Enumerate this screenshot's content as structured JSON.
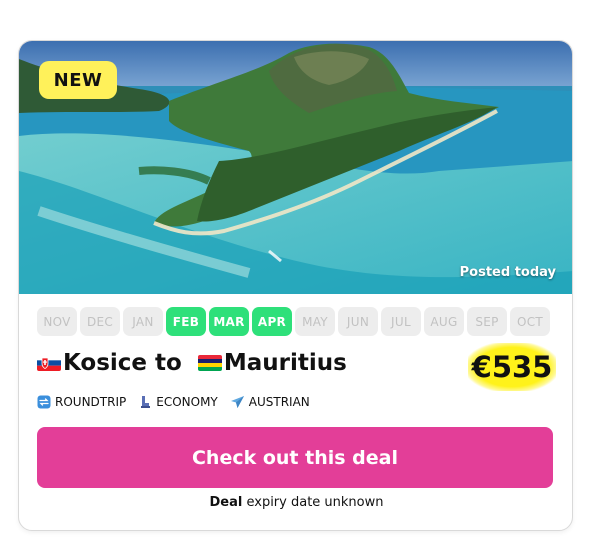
{
  "badge": {
    "label": "NEW"
  },
  "hero": {
    "posted": "Posted today"
  },
  "months": [
    {
      "label": "NOV",
      "active": false
    },
    {
      "label": "DEC",
      "active": false
    },
    {
      "label": "JAN",
      "active": false
    },
    {
      "label": "FEB",
      "active": true
    },
    {
      "label": "MAR",
      "active": true
    },
    {
      "label": "APR",
      "active": true
    },
    {
      "label": "MAY",
      "active": false
    },
    {
      "label": "JUN",
      "active": false
    },
    {
      "label": "JUL",
      "active": false
    },
    {
      "label": "AUG",
      "active": false
    },
    {
      "label": "SEP",
      "active": false
    },
    {
      "label": "OCT",
      "active": false
    }
  ],
  "route": {
    "origin": "Kosice",
    "connector": " to ",
    "destination": "Mauritius"
  },
  "price": {
    "label": "€535"
  },
  "meta": {
    "trip_type": "ROUNDTRIP",
    "cabin": "ECONOMY",
    "airline": "AUSTRIAN"
  },
  "cta": {
    "label": "Check out this deal"
  },
  "expiry": {
    "bold": "Deal",
    "rest": " expiry date unknown"
  },
  "colors": {
    "cta": "#e33e98",
    "month_active": "#2ee07a",
    "badge": "#fff15a",
    "price_highlight": "#fff21a"
  }
}
